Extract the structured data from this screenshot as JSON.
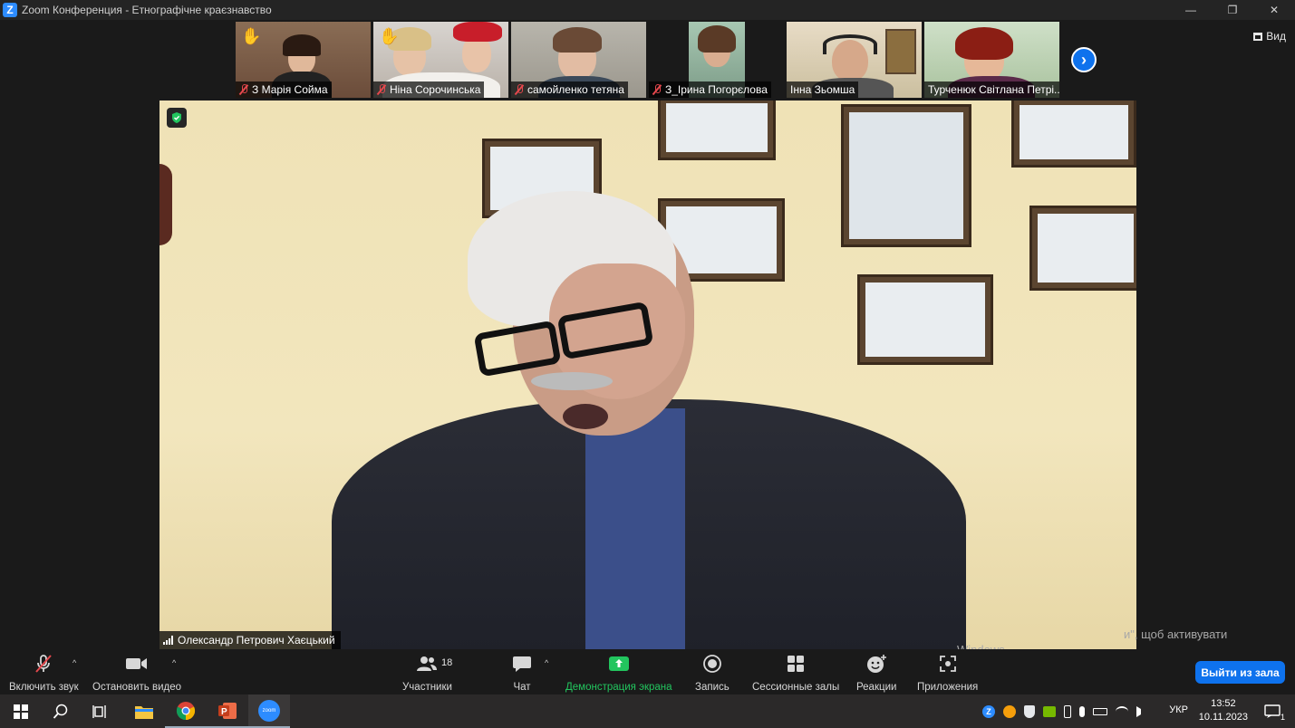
{
  "window": {
    "title": "Zoom Конференция - Етнографічне краєзнавство",
    "logo_letter": "Z",
    "minimize": "—",
    "maximize": "❐",
    "close": "✕"
  },
  "view_button": {
    "label": "Вид"
  },
  "thumbnails": [
    {
      "name": "З Марія Сойма",
      "muted": true,
      "hand": true
    },
    {
      "name": "Ніна Сорочинська",
      "muted": true,
      "hand": true
    },
    {
      "name": "самойленко тетяна",
      "muted": true,
      "hand": false
    },
    {
      "name": "З_Ірина Погорєлова",
      "muted": true,
      "hand": false
    },
    {
      "name": "Інна Зьомша",
      "muted": false,
      "hand": false
    },
    {
      "name": "Турченюк Світлана Петрі...",
      "muted": false,
      "hand": false
    }
  ],
  "next_page": "›",
  "speaker": {
    "name": "Олександр Петрович Хаєцький"
  },
  "watermark": {
    "line1": "и\", щоб активувати",
    "line2": "Windows."
  },
  "toolbar": {
    "unmute": "Включить звук",
    "stop_video": "Остановить видео",
    "participants": "Участники",
    "participants_count": "18",
    "chat": "Чат",
    "share": "Демонстрация экрана",
    "record": "Запись",
    "breakout": "Сессионные залы",
    "reactions": "Реакции",
    "apps": "Приложения",
    "leave": "Выйти из зала",
    "caret": "^"
  },
  "taskbar": {
    "language": "УКР",
    "time": "13:52",
    "date": "10.11.2023",
    "notifications": "1",
    "zoom_label": "zoom"
  },
  "colors": {
    "accent": "#0e72ed",
    "share_green": "#22c55e",
    "muted_red": "#e5484d"
  }
}
